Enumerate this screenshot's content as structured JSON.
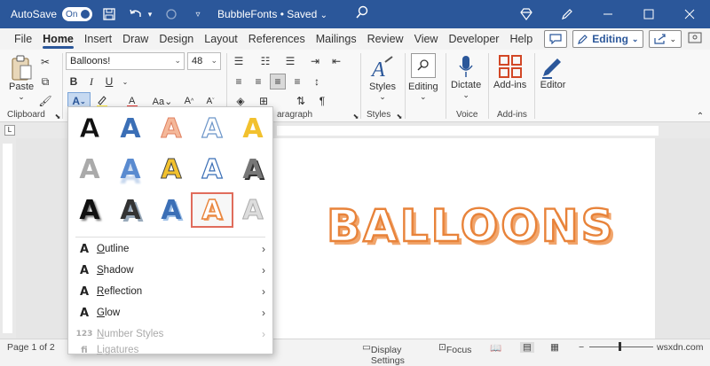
{
  "titlebar": {
    "autosave_label": "AutoSave",
    "toggle_label": "On",
    "doc_title": "BubbleFonts • Saved",
    "bg_color": "#2b579a"
  },
  "menubar": {
    "tabs": [
      "File",
      "Home",
      "Insert",
      "Draw",
      "Design",
      "Layout",
      "References",
      "Mailings",
      "Review",
      "View",
      "Developer",
      "Help"
    ],
    "active_tab": "Home",
    "editing_label": "Editing"
  },
  "ribbon": {
    "font_name": "Balloons!",
    "font_size": "48",
    "paste_label": "Paste",
    "clipboard_label": "Clipboard",
    "paragraph_label": "aragraph",
    "styles_group_label": "Styles",
    "styles_btn": "Styles",
    "editing_btn": "Editing",
    "dictate_btn": "Dictate",
    "voice_label": "Voice",
    "addins_btn": "Add-ins",
    "addins_label": "Add-ins",
    "editor_btn": "Editor"
  },
  "document": {
    "text": "BALLOONS",
    "text_color": "#e8833a"
  },
  "text_effects_menu": {
    "items": [
      {
        "label": "Outline",
        "mnemonic": "O",
        "rest": "utline",
        "icon": "A",
        "enabled": true
      },
      {
        "label": "Shadow",
        "mnemonic": "S",
        "rest": "hadow",
        "icon": "A",
        "enabled": true
      },
      {
        "label": "Reflection",
        "mnemonic": "R",
        "rest": "eflection",
        "icon": "A",
        "enabled": true
      },
      {
        "label": "Glow",
        "mnemonic": "G",
        "rest": "low",
        "icon": "A",
        "enabled": true
      },
      {
        "label": "Number Styles",
        "mnemonic": "N",
        "rest": "umber Styles",
        "icon": "123",
        "enabled": false
      },
      {
        "label": "Ligatures",
        "mnemonic": "L",
        "rest": "igatures",
        "icon": "fi",
        "enabled": false
      }
    ]
  },
  "statusbar": {
    "page": "Page 1 of 2",
    "display_settings": "Display Settings",
    "focus": "Focus",
    "watermark": "wsxdn.com"
  }
}
